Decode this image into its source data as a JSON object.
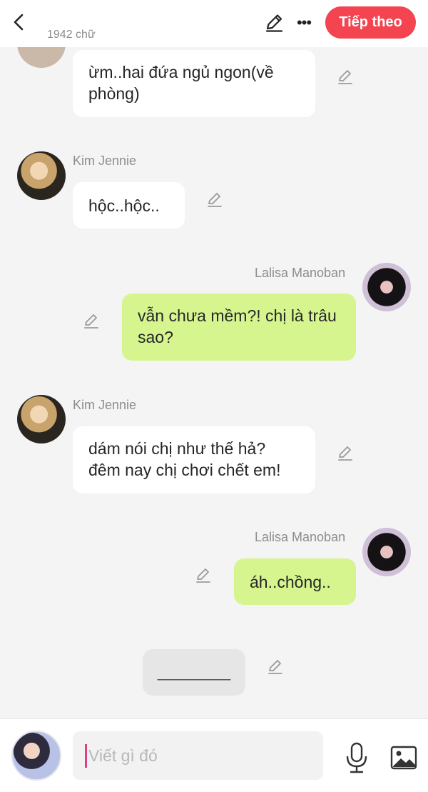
{
  "header": {
    "word_count": "1942 chữ",
    "next_label": "Tiếp theo",
    "back_icon": "chevron-left-icon",
    "edit_icon": "pencil-icon",
    "more_icon": "more-icon"
  },
  "messages": [
    {
      "sender": "",
      "side": "left",
      "text": "ừm..hai đứa ngủ ngon(về phòng)"
    },
    {
      "sender": "Kim Jennie",
      "side": "left",
      "text": "hộc..hộc.."
    },
    {
      "sender": "Lalisa Manoban",
      "side": "right",
      "text": "vẫn chưa mềm?! chị là trâu sao?"
    },
    {
      "sender": "Kim Jennie",
      "side": "left",
      "text": "dám nói chị như thế hả? đêm nay chị chơi chết em!"
    },
    {
      "sender": "Lalisa Manoban",
      "side": "right",
      "text": "áh..chồng.."
    },
    {
      "sender": "",
      "side": "center",
      "text": "________"
    }
  ],
  "composer": {
    "placeholder": "Viết gì đó",
    "value": "",
    "mic_icon": "microphone-icon",
    "image_icon": "image-icon"
  },
  "colors": {
    "accent": "#f4444f",
    "own_bubble": "#d6f58e",
    "other_bubble": "#ffffff",
    "background": "#f4f4f4"
  }
}
